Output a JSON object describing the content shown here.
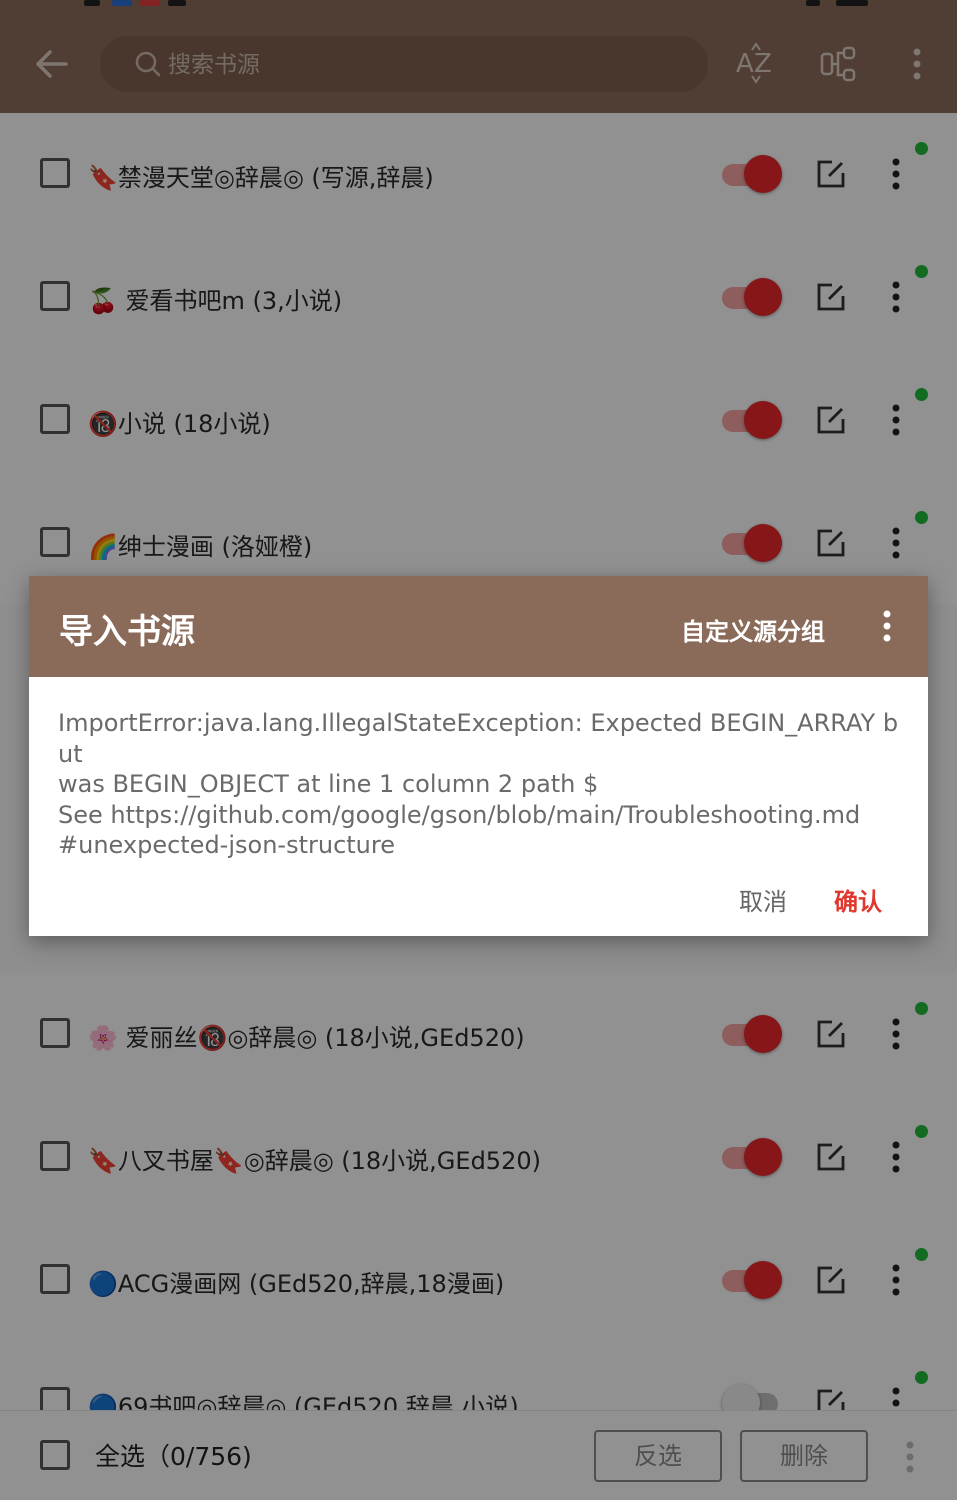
{
  "colors": {
    "primary": "#8a6a58",
    "accent": "#e8262a",
    "online_dot": "#1fb83a",
    "confirm": "#e0382f"
  },
  "search": {
    "placeholder": "搜索书源"
  },
  "sources": [
    {
      "title": "🔖禁漫天堂◎辞晨◎ (写源,辞晨)",
      "enabled": true
    },
    {
      "title": "🍒 爱看书吧m (3,小说)",
      "enabled": true
    },
    {
      "title": "🔞小说 (18小说)",
      "enabled": true
    },
    {
      "title": "🌈绅士漫画 (洛娅橙)",
      "enabled": true
    },
    {
      "title": "🌸 爱丽丝🔞◎辞晨◎ (18小说,GEd520)",
      "enabled": true
    },
    {
      "title": "🔖八叉书屋🔖◎辞晨◎ (18小说,GEd520)",
      "enabled": true
    },
    {
      "title": "🔵ACG漫画网 (GEd520,辞晨,18漫画)",
      "enabled": true
    },
    {
      "title": "🔵69书吧◎辞晨◎ (GEd520,辞晨,小说)",
      "enabled": false
    }
  ],
  "bottom": {
    "select_all": "全选（0/756)",
    "invert": "反选",
    "delete": "删除"
  },
  "dialog": {
    "title": "导入书源",
    "action": "自定义源分组",
    "message": "ImportError:java.lang.IllegalStateException: Expected BEGIN_ARRAY but\nwas BEGIN_OBJECT at line 1 column 2 path $\nSee https://github.com/google/gson/blob/main/Troubleshooting.md\n#unexpected-json-structure",
    "cancel": "取消",
    "confirm": "确认"
  }
}
